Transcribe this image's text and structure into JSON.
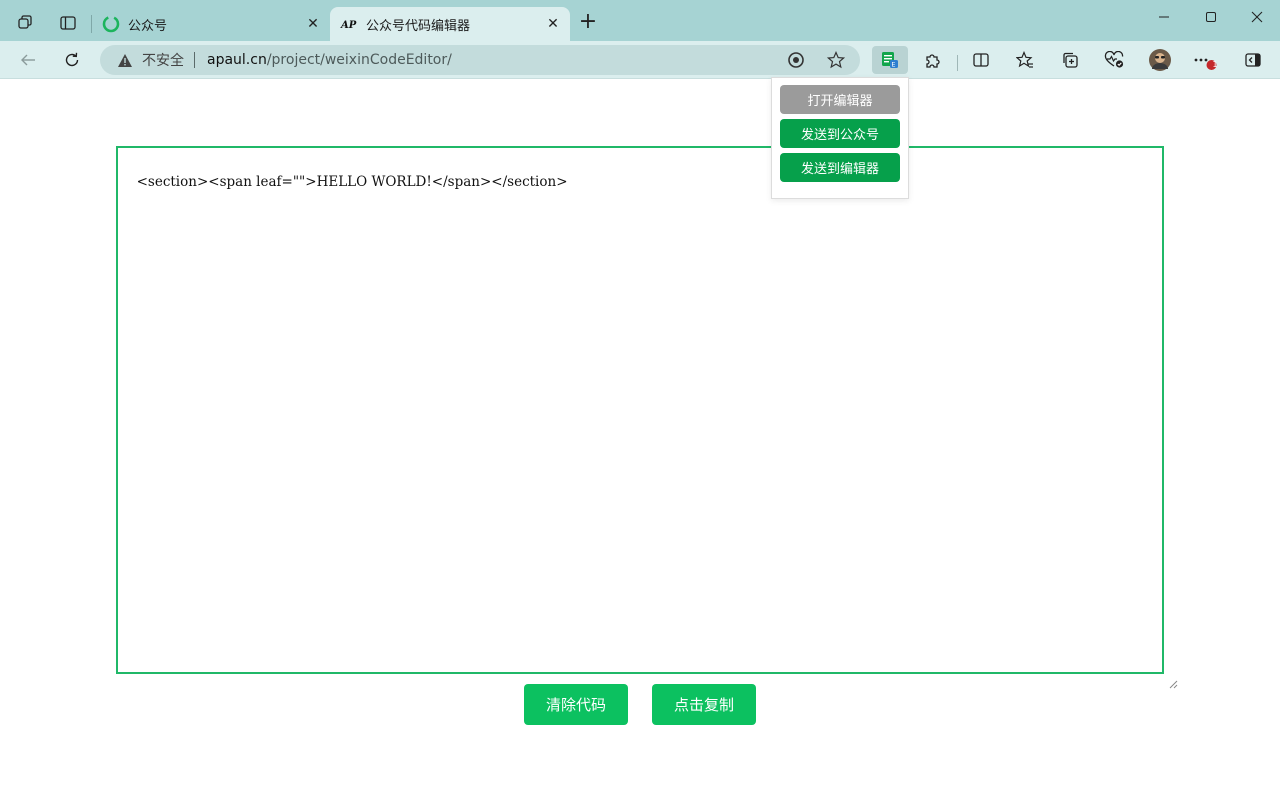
{
  "tabs": [
    {
      "title": "公众号",
      "active": false
    },
    {
      "title": "公众号代码编辑器",
      "active": true
    }
  ],
  "address_bar": {
    "security_label": "不安全",
    "host": "apaul.cn",
    "path": "/project/weixinCodeEditor/"
  },
  "toolbar": {
    "notification_badge": "1"
  },
  "extension_popup": {
    "open_editor_label": "打开编辑器",
    "send_to_account_label": "发送到公众号",
    "send_to_editor_label": "发送到编辑器"
  },
  "editor": {
    "code": "<section><span leaf=\"\">HELLO WORLD!</span></section>"
  },
  "actions": {
    "clear_label": "清除代码",
    "copy_label": "点击复制"
  },
  "colors": {
    "tabbar_bg": "#a6d3d3",
    "toolbar_bg": "#dbeeee",
    "accent_green": "#0cc160",
    "popup_green": "#06a04b",
    "popup_gray": "#9b9b9b",
    "editor_border": "#20b868"
  },
  "icons": {
    "workspaces": "workspaces-icon",
    "tab_actions": "tab-actions-icon",
    "wechat_favicon": "wechat-favicon-icon",
    "site_favicon": "ap-favicon-icon",
    "back": "back-arrow-icon",
    "refresh": "refresh-icon",
    "warning": "warning-icon",
    "read_aloud": "read-aloud-icon",
    "favorite": "star-icon",
    "extension_active": "wechat-editor-extension-icon",
    "extensions": "puzzle-icon",
    "split_screen": "split-screen-icon",
    "favorites": "favorites-icon",
    "collections": "collections-icon",
    "performance": "heartbeat-icon",
    "profile": "avatar",
    "more": "more-icon",
    "sidebar": "sidebar-icon"
  }
}
